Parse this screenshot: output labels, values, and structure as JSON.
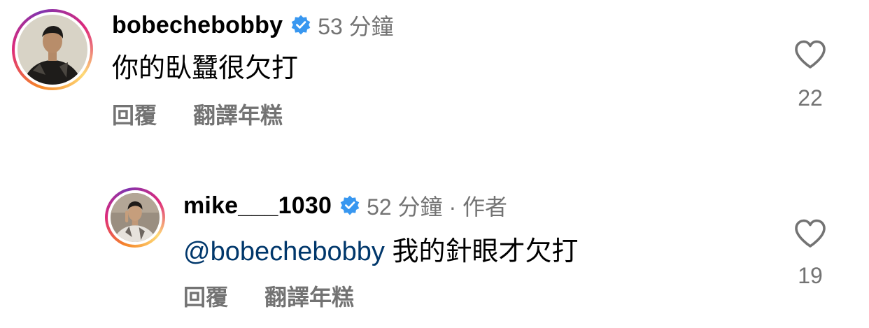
{
  "comments": [
    {
      "username": "bobechebobby",
      "meta": "53 分鐘",
      "text": "你的臥蠶很欠打",
      "reply_label": "回覆",
      "translate_label": "翻譯年糕",
      "likes": "22"
    },
    {
      "username": "mike___1030",
      "meta": "52 分鐘 · 作者",
      "mention": "@bobechebobby",
      "text": " 我的針眼才欠打",
      "reply_label": "回覆",
      "translate_label": "翻譯年糕",
      "likes": "19"
    }
  ],
  "colors": {
    "verified": "#3897f0",
    "meta": "#737373",
    "mention": "#00376b"
  }
}
